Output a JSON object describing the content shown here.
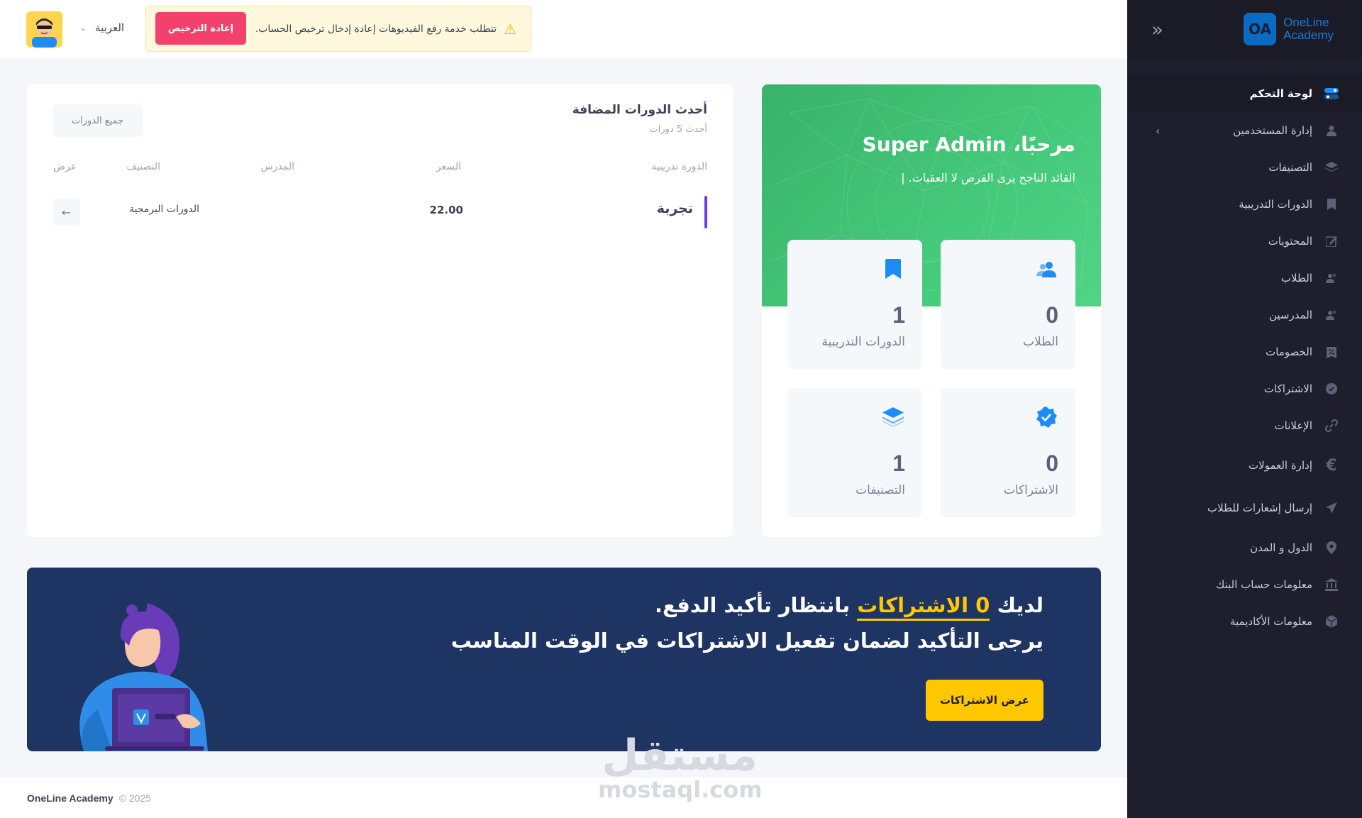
{
  "sidebar": {
    "logo": {
      "mark": "OA",
      "line1": "OneLine",
      "line2": "Academy"
    },
    "items": [
      {
        "label": "لوحة التحكم",
        "icon": "toggle-icon",
        "active": true
      },
      {
        "label": "إدارة المستخدمين",
        "icon": "user-icon",
        "has_arrow": true
      },
      {
        "label": "التصنيفات",
        "icon": "layers-icon"
      },
      {
        "label": "الدورات التدريبية",
        "icon": "bookmark-icon"
      },
      {
        "label": "المحتويات",
        "icon": "edit-icon"
      },
      {
        "label": "الطلاب",
        "icon": "users-icon"
      },
      {
        "label": "المدرسين",
        "icon": "teachers-icon"
      },
      {
        "label": "الخصومات",
        "icon": "discount-icon"
      },
      {
        "label": "الاشتراكات",
        "icon": "verified-icon"
      },
      {
        "label": "الإعلانات",
        "icon": "link-icon"
      },
      {
        "label": "إدارة العمولات",
        "icon": "euro-icon"
      },
      {
        "label": "إرسال إشعارات للطلاب",
        "icon": "send-icon"
      },
      {
        "label": "الدول و المدن",
        "icon": "map-pin-icon"
      },
      {
        "label": "معلومات حساب البنك",
        "icon": "bank-icon"
      },
      {
        "label": "معلومات الأكاديمية",
        "icon": "cube-icon"
      }
    ]
  },
  "topbar": {
    "alert_text": "تتطلب خدمة رفع الفيديوهات إعادة إدخال ترخيص الحساب.",
    "relicense_label": "إعادة الترخيص",
    "language": "العربية"
  },
  "welcome": {
    "title": "مرحبًا، Super Admin",
    "subtitle": "القائد الناجح يرى الفرص لا العقبات. |",
    "stats": [
      {
        "value": "0",
        "label": "الطلاب",
        "icon": "users-icon"
      },
      {
        "value": "1",
        "label": "الدورات التدريبية",
        "icon": "bookmark-icon"
      },
      {
        "value": "0",
        "label": "الاشتراكات",
        "icon": "verified-icon"
      },
      {
        "value": "1",
        "label": "التصنيفات",
        "icon": "layers-icon"
      }
    ]
  },
  "courses": {
    "title": "أحدث الدورات المضافة",
    "subtitle": "أحدث 5 دورات",
    "all_button": "جميع الدورات",
    "columns": [
      "الدورة تدريبية",
      "السعر",
      "المدرس",
      "التصنيف",
      "عرض"
    ],
    "rows": [
      {
        "name": "تجربة",
        "price": "22.00",
        "teacher": "",
        "category": "الدورات البرمجية"
      }
    ]
  },
  "banner": {
    "line1_before": "لديك",
    "line1_highlight": "0 الاشتراكات",
    "line1_after": "بانتظار تأكيد الدفع.",
    "line2": "يرجى التأكيد لضمان تفعيل الاشتراكات في الوقت المناسب",
    "button": "عرض الاشتراكات"
  },
  "footer": {
    "brand": "OneLine Academy",
    "copy": "© 2025"
  },
  "watermark": {
    "line1": "مستقل",
    "line2": "mostaql.com"
  },
  "colors": {
    "sidebar_bg": "#1e1e2d",
    "accent_blue": "#1d8cf8",
    "green": "#45c97a",
    "danger": "#f1416c",
    "warning": "#ffc700",
    "banner_bg": "#1e3462",
    "purple": "#7239ea"
  }
}
